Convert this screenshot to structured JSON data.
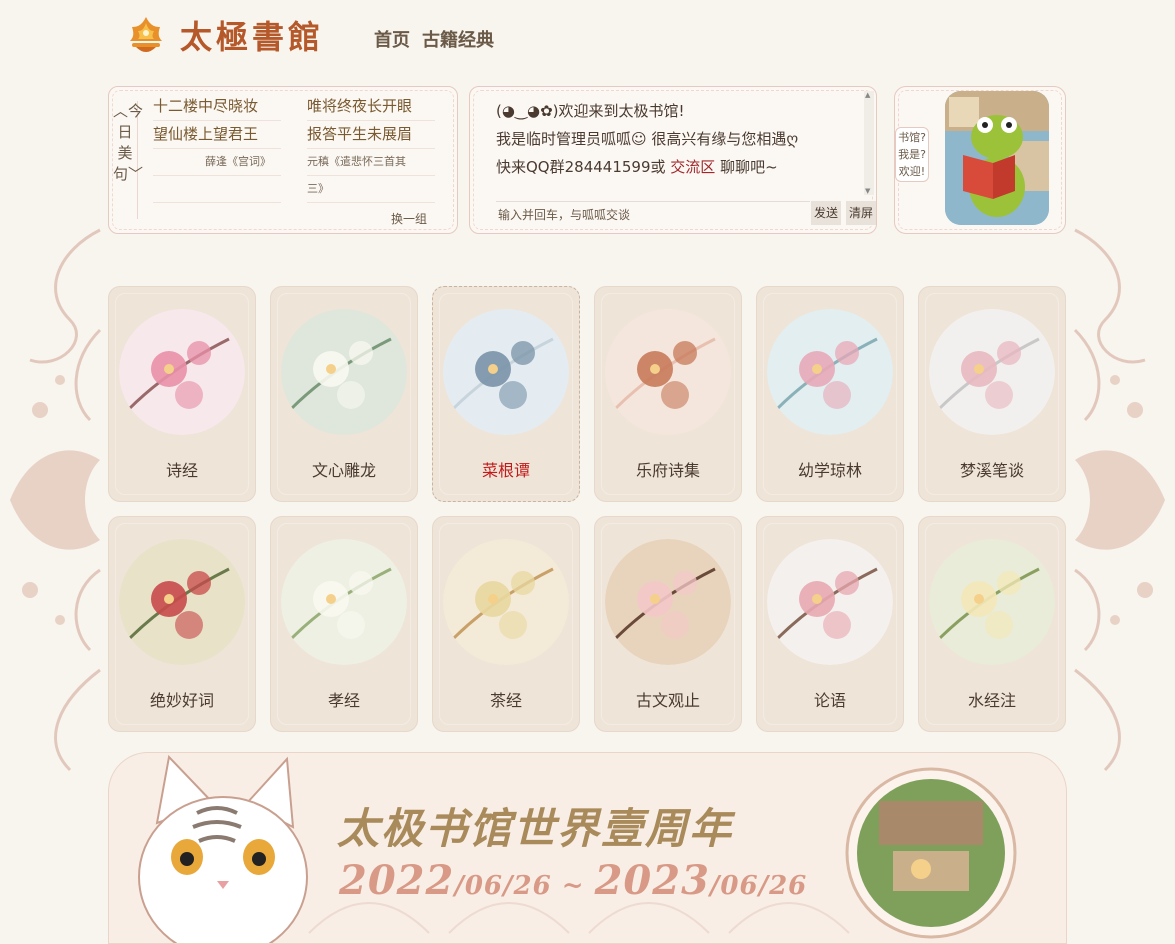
{
  "header": {
    "logo_text": "太極書館",
    "nav": [
      "首页",
      "古籍经典"
    ]
  },
  "poem": {
    "vertical_label": "︿今日美句﹀",
    "col1_line1": "十二楼中尽晓妆",
    "col1_line2": "望仙楼上望君王",
    "col1_source": "薛逢《宫词》",
    "col2_line1": "唯将终夜长开眼",
    "col2_line2": "报答平生未展眉",
    "col2_source_a": "元稹《遣悲怀三首其",
    "col2_source_b": "三》",
    "swap_label": "换一组"
  },
  "chat": {
    "line1": "(◕‿◕✿)欢迎来到太极书馆!",
    "line2": "我是临时管理员呱呱☺ 很高兴有缘与您相遇ღ",
    "line3_prefix": "快来QQ群284441599或 ",
    "line3_link": "交流区",
    "line3_suffix": "  聊聊吧~",
    "input_placeholder": "输入并回车，与呱呱交谈",
    "send_label": "发送",
    "clear_label": "清屏"
  },
  "admin": {
    "tag": [
      "书馆?",
      "我是?",
      "欢迎!"
    ]
  },
  "books": [
    {
      "label": "诗经"
    },
    {
      "label": "文心雕龙"
    },
    {
      "label": "菜根谭"
    },
    {
      "label": "乐府诗集"
    },
    {
      "label": "幼学琼林"
    },
    {
      "label": "梦溪笔谈"
    },
    {
      "label": "绝妙好词"
    },
    {
      "label": "孝经"
    },
    {
      "label": "茶经"
    },
    {
      "label": "古文观止"
    },
    {
      "label": "论语"
    },
    {
      "label": "水经注"
    }
  ],
  "active_book": "菜根谭",
  "banner": {
    "title": "太极书馆世界壹周年",
    "date_start_year": "2022",
    "date_start_rest": "/06/26",
    "date_sep": " ~ ",
    "date_end_year": "2023",
    "date_end_rest": "/06/26"
  },
  "colors": {
    "page_bg": "#f8f4ee",
    "logo": "#b5582a",
    "active_label": "#c21a1a",
    "link": "#a0262b"
  }
}
